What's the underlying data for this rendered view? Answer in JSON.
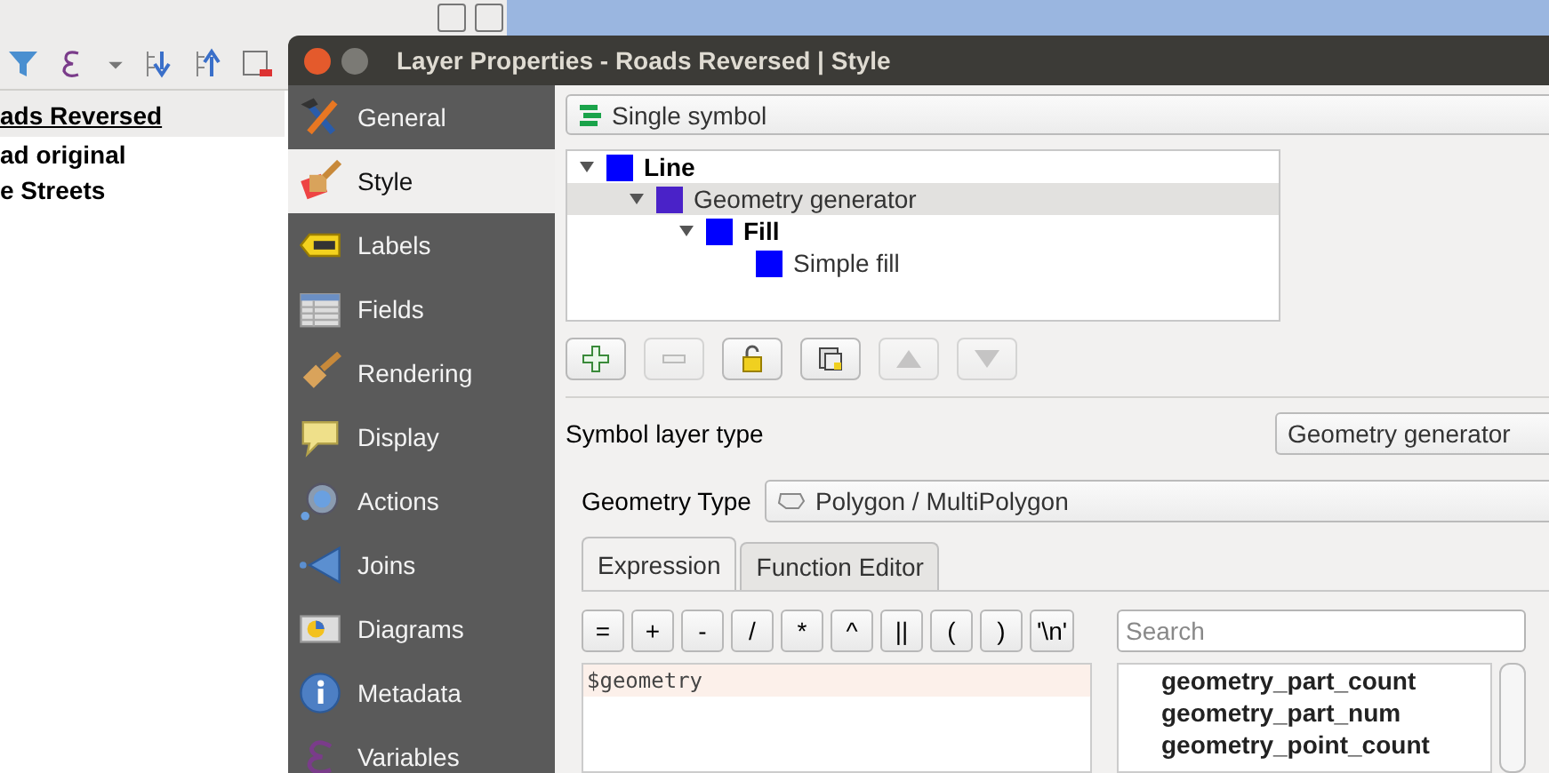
{
  "background_window": {
    "panel_heading": "ads Reversed",
    "layers": [
      {
        "name": "ad original"
      },
      {
        "name": "e Streets"
      }
    ]
  },
  "dialog": {
    "title": "Layer Properties - Roads Reversed | Style",
    "sidebar": {
      "items": [
        {
          "label": "General",
          "selected": false
        },
        {
          "label": "Style",
          "selected": true
        },
        {
          "label": "Labels",
          "selected": false
        },
        {
          "label": "Fields",
          "selected": false
        },
        {
          "label": "Rendering",
          "selected": false
        },
        {
          "label": "Display",
          "selected": false
        },
        {
          "label": "Actions",
          "selected": false
        },
        {
          "label": "Joins",
          "selected": false
        },
        {
          "label": "Diagrams",
          "selected": false
        },
        {
          "label": "Metadata",
          "selected": false
        },
        {
          "label": "Variables",
          "selected": false
        }
      ]
    },
    "renderer": {
      "value": "Single symbol"
    },
    "symbol_tree": [
      {
        "label": "Line",
        "kind": "symbol",
        "color": "#0000ff",
        "selected": false,
        "expanded": true,
        "children": [
          {
            "label": "Geometry generator",
            "kind": "layer",
            "color": "#4a22c8",
            "selected": true,
            "expanded": true,
            "children": [
              {
                "label": "Fill",
                "kind": "symbol",
                "color": "#0000ff",
                "selected": false,
                "expanded": true,
                "children": [
                  {
                    "label": "Simple fill",
                    "kind": "layer",
                    "color": "#0000ff",
                    "selected": false
                  }
                ]
              }
            ]
          }
        ]
      }
    ],
    "tree_buttons": [
      {
        "kind": "add",
        "disabled": false
      },
      {
        "kind": "remove",
        "disabled": true
      },
      {
        "kind": "lock",
        "disabled": false
      },
      {
        "kind": "duplicate",
        "disabled": false
      },
      {
        "kind": "up",
        "disabled": true
      },
      {
        "kind": "down",
        "disabled": true
      }
    ],
    "symbol_layer_type": {
      "label": "Symbol layer type",
      "value": "Geometry generator"
    },
    "geometry_type": {
      "label": "Geometry Type",
      "value": "Polygon / MultiPolygon"
    },
    "tabs": [
      {
        "label": "Expression",
        "selected": true
      },
      {
        "label": "Function Editor",
        "selected": false
      }
    ],
    "operators": [
      "=",
      "+",
      "-",
      "/",
      "*",
      "^",
      "||",
      "(",
      ")",
      "'\\n'"
    ],
    "search": {
      "placeholder": "Search"
    },
    "expression": {
      "value": "$geometry"
    },
    "functions": [
      "geometry_part_count",
      "geometry_part_num",
      "geometry_point_count"
    ]
  }
}
